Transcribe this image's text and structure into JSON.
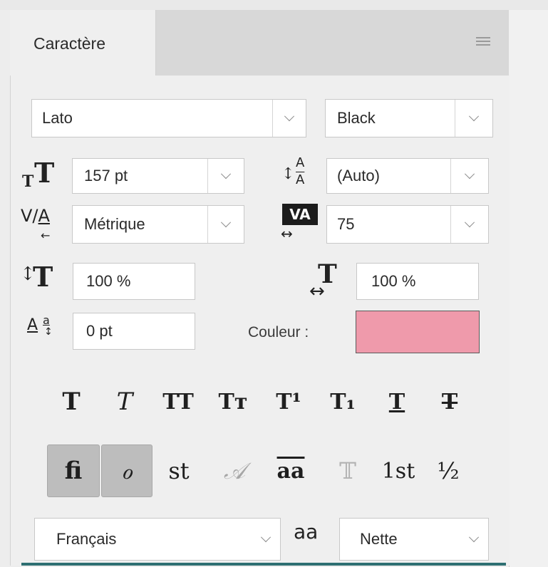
{
  "panel": {
    "tab_label": "Caractère"
  },
  "font": {
    "family": "Lato",
    "style": "Black"
  },
  "size": {
    "font_size": "157 pt",
    "leading": "(Auto)"
  },
  "spacing": {
    "kerning": "Métrique",
    "tracking": "75"
  },
  "scale": {
    "vertical": "100 %",
    "horizontal": "100 %"
  },
  "baseline": {
    "shift": "0 pt"
  },
  "color": {
    "label": "Couleur :",
    "value": "#ef9aab"
  },
  "style_buttons": [
    {
      "glyph": "T",
      "name": "faux-bold"
    },
    {
      "glyph": "T",
      "name": "faux-italic"
    },
    {
      "glyph": "TT",
      "name": "all-caps"
    },
    {
      "glyph": "Tт",
      "name": "small-caps"
    },
    {
      "glyph": "T¹",
      "name": "superscript"
    },
    {
      "glyph": "T₁",
      "name": "subscript"
    },
    {
      "glyph": "T",
      "name": "underline"
    },
    {
      "glyph": "T",
      "name": "strikethrough"
    }
  ],
  "opentype_buttons": [
    {
      "glyph": "fi",
      "name": "standard-ligatures",
      "active": true
    },
    {
      "glyph": "ℴ",
      "name": "contextual-alternates",
      "active": true
    },
    {
      "glyph": "st",
      "name": "discretionary-ligatures",
      "active": false
    },
    {
      "glyph": "𝒜",
      "name": "swash",
      "active": false
    },
    {
      "glyph": "aa",
      "name": "stylistic-alternates",
      "active": false
    },
    {
      "glyph": "𝕋",
      "name": "titling-alternates",
      "active": false
    },
    {
      "glyph": "1st",
      "name": "ordinals",
      "active": false
    },
    {
      "glyph": "½",
      "name": "fractions",
      "active": false
    }
  ],
  "language": {
    "value": "Français",
    "aa_glyph": "aa",
    "antialias": "Nette"
  }
}
